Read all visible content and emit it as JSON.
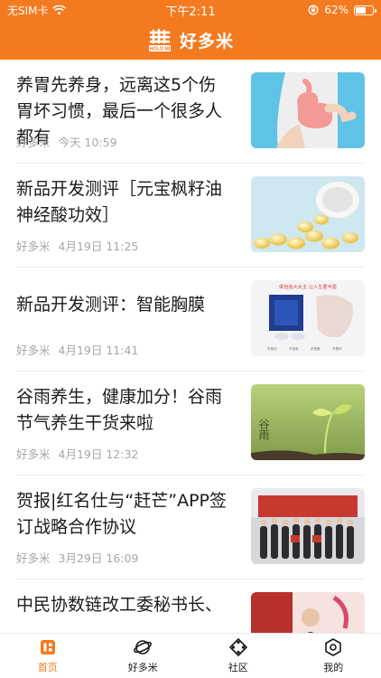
{
  "status_bar": {
    "carrier": "无SIM卡",
    "time": "下午2:11",
    "battery": "62%",
    "battery_level": 0.62
  },
  "header": {
    "title": "好多米",
    "logo_text": "HOLD MI"
  },
  "feed": [
    {
      "title": "养胃先养身，远离这5个伤胃坏习惯，最后一个很多人都有",
      "source": "好多米",
      "time": "今天 10:59",
      "thumb": "stomach-health-photo"
    },
    {
      "title": "新品开发测评［元宝枫籽油神经酸功效］",
      "source": "好多米",
      "time": "4月19日 11:25",
      "thumb": "softgel-capsules-photo"
    },
    {
      "title": "新品开发测评：智能胸膜",
      "source": "好多米",
      "time": "4月19日 11:41",
      "thumb": "product-ad-photo",
      "thumb_caption": "做自信大女主 让人生更丰盈",
      "thumb_tags": [
        "不钝万",
        "不奈米",
        "不压胖",
        "不憋坏"
      ]
    },
    {
      "title": "谷雨养生，健康加分！谷雨节气养生干货来啦",
      "source": "好多米",
      "time": "4月19日 12:32",
      "thumb": "grain-rain-sprout-photo",
      "thumb_caption": "谷雨"
    },
    {
      "title": "贺报|红名仕与“赶芒”APP签订战略合作协议",
      "source": "好多米",
      "time": "3月29日 16:09",
      "thumb": "group-signing-photo"
    },
    {
      "title": "中民协数链改工委秘书长、",
      "source": "",
      "time": "",
      "thumb": "conference-photo"
    }
  ],
  "tabs": [
    {
      "label": "首页",
      "icon": "home-icon",
      "active": true
    },
    {
      "label": "好多米",
      "icon": "planet-icon",
      "active": false
    },
    {
      "label": "社区",
      "icon": "community-icon",
      "active": false
    },
    {
      "label": "我的",
      "icon": "profile-icon",
      "active": false
    }
  ],
  "colors": {
    "brand": "#f47a1f",
    "meta": "#a6a6a6",
    "text": "#1b1b1b"
  }
}
